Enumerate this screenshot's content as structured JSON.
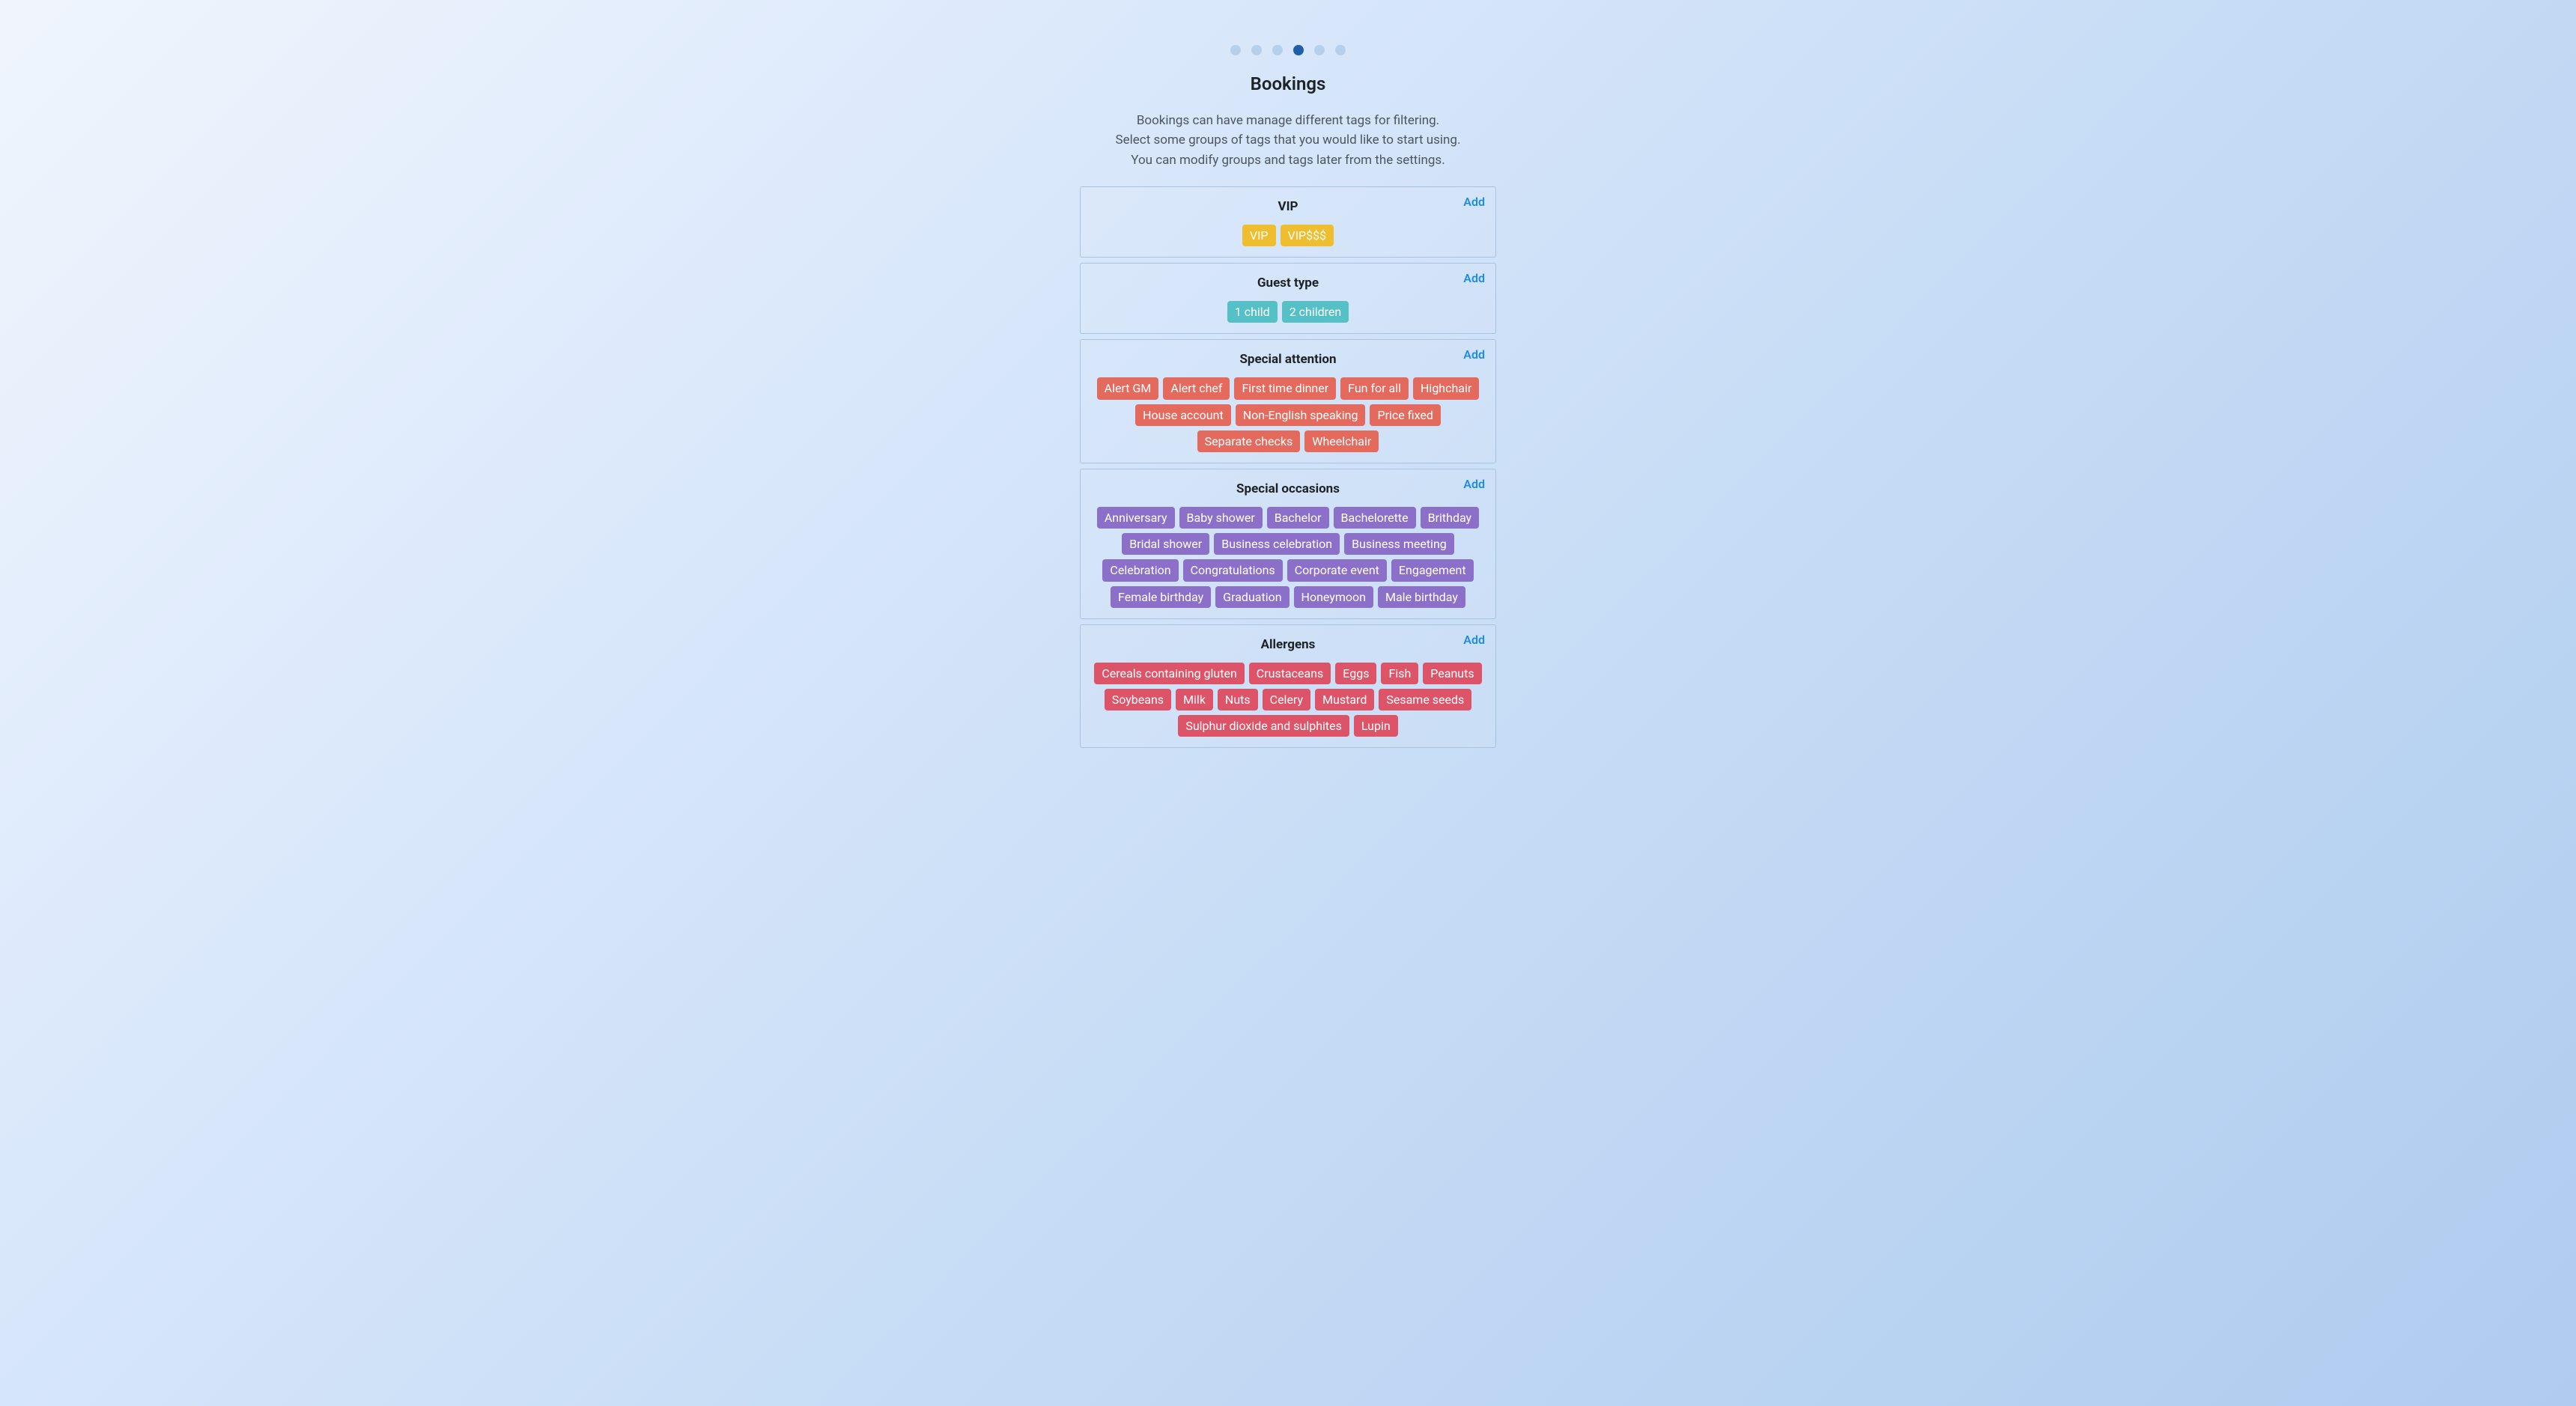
{
  "stepper": {
    "total": 6,
    "activeIndex": 3
  },
  "title": "Bookings",
  "description": [
    "Bookings can have manage different tags for filtering.",
    "Select some groups of tags that you would like to start using.",
    "You can modify groups and tags later from the settings."
  ],
  "addLabel": "Add",
  "groups": [
    {
      "name": "VIP",
      "color": "yellow",
      "tags": [
        "VIP",
        "VIP$$$"
      ]
    },
    {
      "name": "Guest type",
      "color": "teal",
      "tags": [
        "1 child",
        "2 children"
      ]
    },
    {
      "name": "Special attention",
      "color": "red",
      "tags": [
        "Alert GM",
        "Alert chef",
        "First time dinner",
        "Fun for all",
        "Highchair",
        "House account",
        "Non-English speaking",
        "Price fixed",
        "Separate checks",
        "Wheelchair"
      ]
    },
    {
      "name": "Special occasions",
      "color": "purple",
      "tags": [
        "Anniversary",
        "Baby shower",
        "Bachelor",
        "Bachelorette",
        "Brithday",
        "Bridal shower",
        "Business celebration",
        "Business meeting",
        "Celebration",
        "Congratulations",
        "Corporate event",
        "Engagement",
        "Female birthday",
        "Graduation",
        "Honeymoon",
        "Male birthday"
      ]
    },
    {
      "name": "Allergens",
      "color": "crimson",
      "tags": [
        "Cereals containing gluten",
        "Crustaceans",
        "Eggs",
        "Fish",
        "Peanuts",
        "Soybeans",
        "Milk",
        "Nuts",
        "Celery",
        "Mustard",
        "Sesame seeds",
        "Sulphur dioxide and sulphites",
        "Lupin"
      ]
    }
  ]
}
